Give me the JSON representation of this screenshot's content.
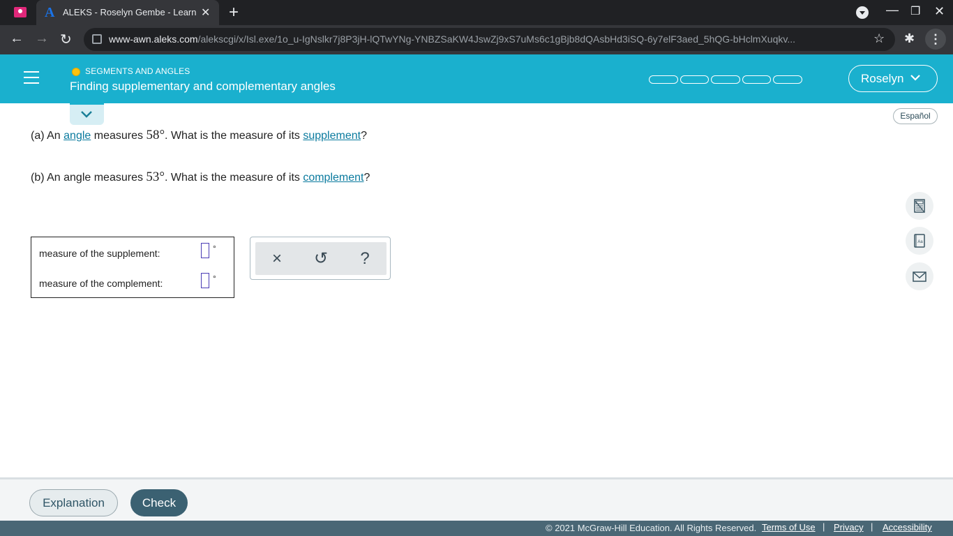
{
  "browser": {
    "tab_title": "ALEKS - Roselyn Gembe - Learn",
    "tab_close": "✕",
    "new_tab": "+",
    "url_host": "www-awn.aleks.com",
    "url_path": "/alekscgi/x/Isl.exe/1o_u-IgNslkr7j8P3jH-lQTwYNg-YNBZSaKW4JswZj9xS7uMs6c1gBjb8dQAsbHd3iSQ-6y7elF3aed_5hQG-bHclmXuqkv...",
    "favicon": "A"
  },
  "header": {
    "topic": "SEGMENTS AND ANGLES",
    "title": "Finding supplementary and complementary angles",
    "user": "Roselyn",
    "progress": {
      "segments": 5,
      "filled": 0
    }
  },
  "espanol": "Español",
  "question_a": {
    "prefix": "(a) An ",
    "link1": "angle",
    "mid1": " measures ",
    "value": "58°",
    "mid2": ". What is the measure of its ",
    "link2": "supplement",
    "suffix": "?"
  },
  "question_b": {
    "prefix": "(b) An angle measures ",
    "value": "53°",
    "mid": ". What is the measure of its ",
    "link": "complement",
    "suffix": "?"
  },
  "answers": {
    "supplement_label": "measure of the supplement:",
    "complement_label": "measure of the complement:",
    "supplement_value": "",
    "complement_value": "",
    "degree": "°"
  },
  "tools": {
    "clear": "×",
    "undo": "↺",
    "help": "?"
  },
  "bottom": {
    "explanation": "Explanation",
    "check": "Check"
  },
  "footer": {
    "copyright": "© 2021 McGraw-Hill Education. All Rights Reserved.",
    "terms": "Terms of Use",
    "privacy": "Privacy",
    "accessibility": "Accessibility",
    "separator": "|"
  }
}
